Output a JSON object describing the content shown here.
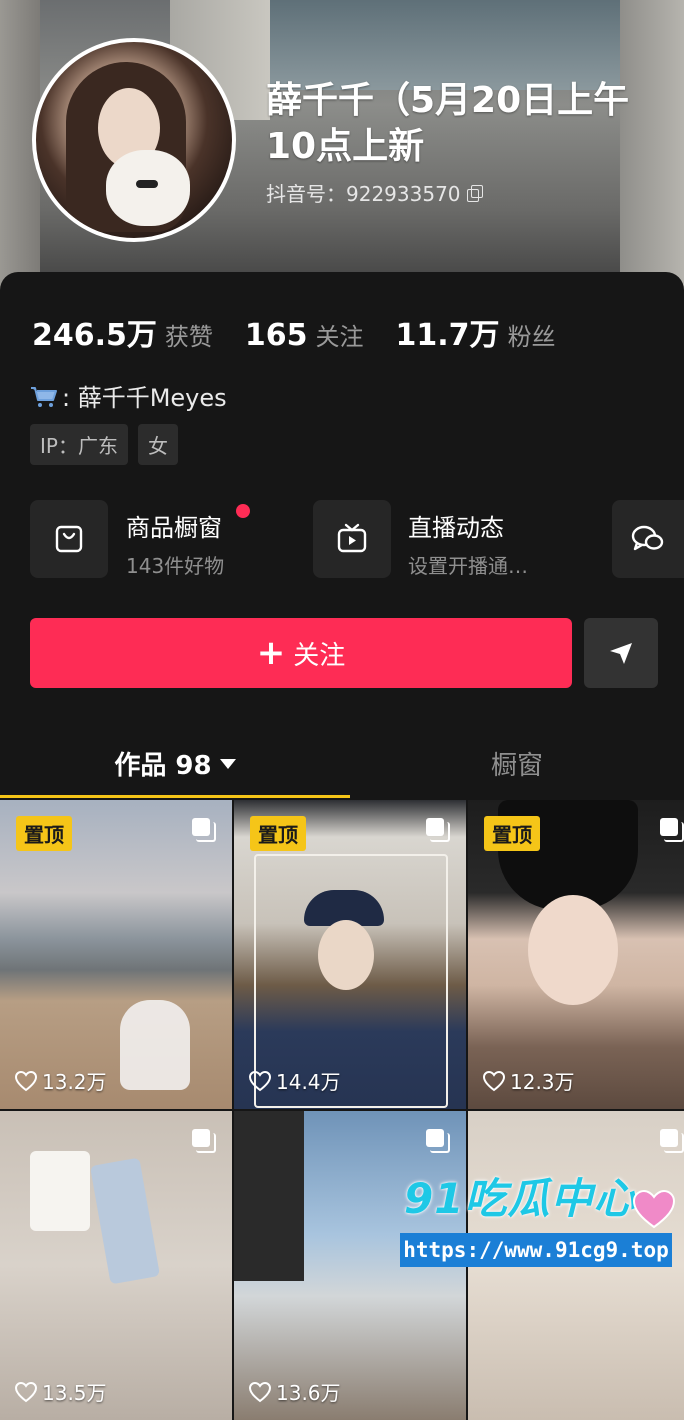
{
  "profile": {
    "name": "薛千千（5月20日上午10点上新",
    "douyin_id": "抖音号：922933570"
  },
  "stats": [
    {
      "value": "246.5万",
      "label": "获赞"
    },
    {
      "value": "165",
      "label": "关注"
    },
    {
      "value": "11.7万",
      "label": "粉丝"
    }
  ],
  "shop": {
    "text": ": 薛千千Meyes"
  },
  "tags": [
    "IP：广东",
    "女"
  ],
  "entries": [
    {
      "title": "商品橱窗",
      "subtitle": "143件好物",
      "icon": "bag-icon",
      "has_dot": true
    },
    {
      "title": "直播动态",
      "subtitle": "设置开播通…",
      "icon": "tv-icon",
      "has_dot": false
    }
  ],
  "actions": {
    "follow": "关注",
    "follow_plus": "+"
  },
  "tabs": {
    "works": "作品 98",
    "window": "橱窗"
  },
  "posts": [
    {
      "pinned": true,
      "pin_label": "置顶",
      "likes": "13.2万"
    },
    {
      "pinned": true,
      "pin_label": "置顶",
      "likes": "14.4万"
    },
    {
      "pinned": true,
      "pin_label": "置顶",
      "likes": "12.3万"
    },
    {
      "pinned": false,
      "likes": "13.5万"
    },
    {
      "pinned": false,
      "likes": "13.6万"
    },
    {
      "pinned": false,
      "likes": ""
    }
  ],
  "watermark": {
    "logo": "91吃瓜中心",
    "url": "https://www.91cg9.top"
  },
  "colors": {
    "accent": "#fe2c55",
    "pin": "#f5c518",
    "tab_underline": "#f5c518"
  }
}
